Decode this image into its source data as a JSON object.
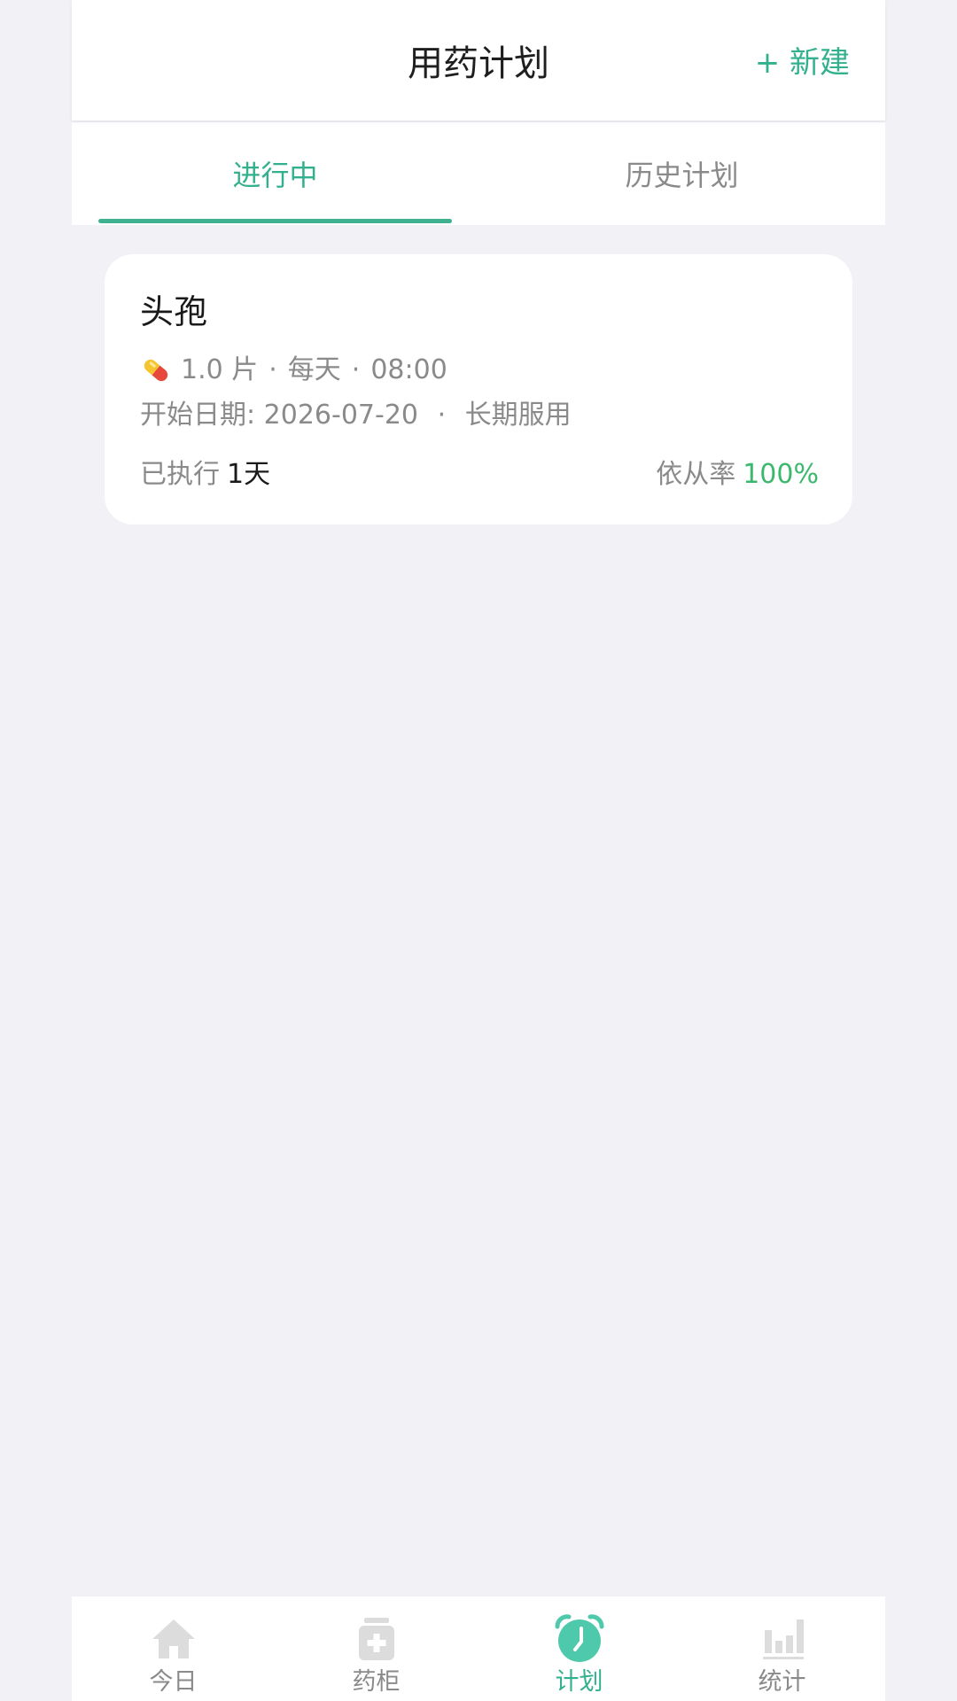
{
  "header": {
    "title": "用药计划",
    "new_label": "+ 新建"
  },
  "tabs": [
    {
      "label": "进行中",
      "active": true
    },
    {
      "label": "历史计划",
      "active": false
    }
  ],
  "plans": [
    {
      "name": "头孢",
      "dose": "1.0 片",
      "frequency": "每天",
      "time": "08:00",
      "start_label": "开始日期:",
      "start_date": "2026-07-20",
      "duration": "长期服用",
      "executed_label": "已执行",
      "executed_value": "1天",
      "adherence_label": "依从率",
      "adherence_value": "100%"
    }
  ],
  "separator": "·",
  "bottom_nav": [
    {
      "label": "今日",
      "icon": "home-icon",
      "active": false
    },
    {
      "label": "药柜",
      "icon": "medicine-cabinet-icon",
      "active": false
    },
    {
      "label": "计划",
      "icon": "alarm-clock-icon",
      "active": true
    },
    {
      "label": "统计",
      "icon": "bar-chart-icon",
      "active": false
    }
  ],
  "colors": {
    "accent": "#33b08e",
    "success": "#3cb86e",
    "background": "#f1f1f6"
  }
}
